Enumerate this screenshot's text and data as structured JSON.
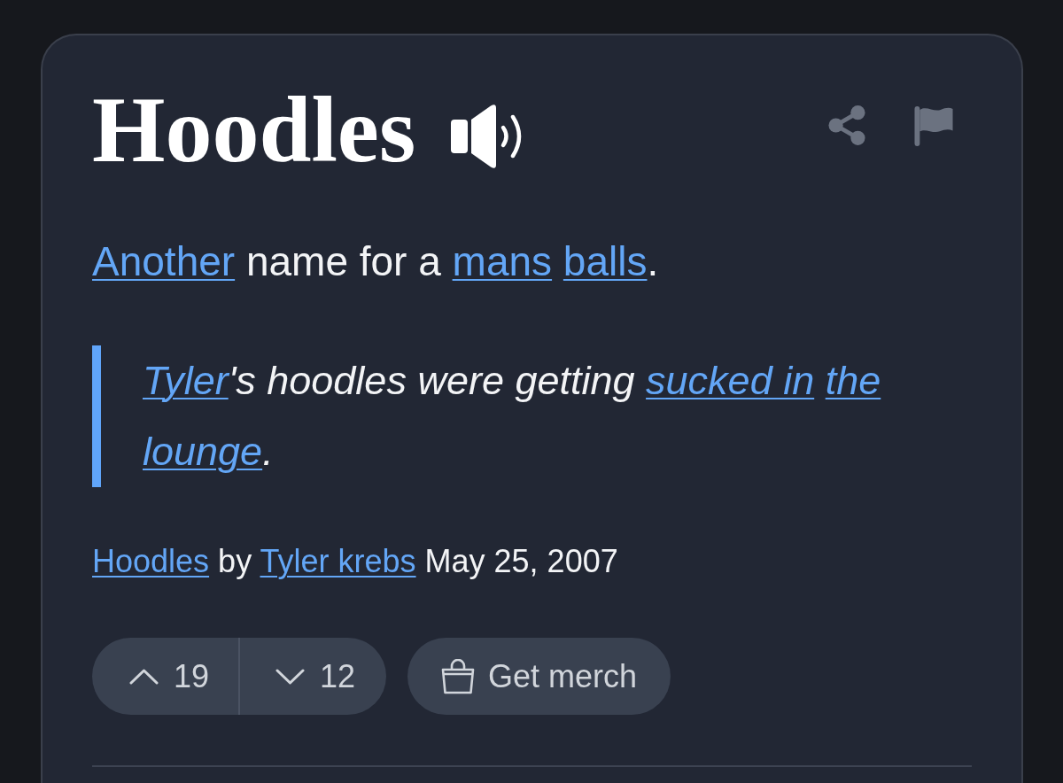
{
  "entry": {
    "word": "Hoodles",
    "definition": [
      {
        "kind": "link",
        "text": "Another"
      },
      {
        "kind": "text",
        "text": "name for a"
      },
      {
        "kind": "link",
        "text": "mans"
      },
      {
        "kind": "link",
        "text": "balls"
      },
      {
        "kind": "suffix",
        "text": "."
      }
    ],
    "example": [
      {
        "kind": "link",
        "text": "Tyler"
      },
      {
        "kind": "suffix",
        "text": "'s hoodles were getting"
      },
      {
        "kind": "link",
        "text": "sucked in"
      },
      {
        "kind": "link",
        "text": "the"
      },
      {
        "kind": "link",
        "text": "lounge"
      },
      {
        "kind": "suffix",
        "text": "."
      }
    ],
    "byline": [
      {
        "kind": "link",
        "text": "Hoodles"
      },
      {
        "kind": "text",
        "text": "by"
      },
      {
        "kind": "link",
        "text": "Tyler krebs"
      },
      {
        "kind": "text",
        "text": "May 25, 2007"
      }
    ],
    "votes": [
      {
        "kind": "up",
        "count": "19"
      },
      {
        "kind": "down",
        "count": "12"
      }
    ],
    "merch_button": {
      "label": "Get merch"
    }
  }
}
